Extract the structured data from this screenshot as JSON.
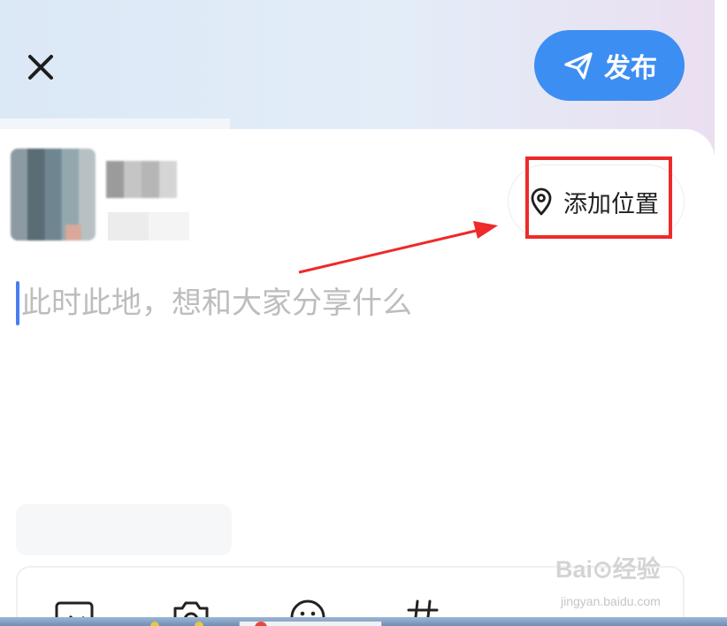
{
  "header": {
    "close_icon": "close-icon",
    "publish_label": "发布",
    "publish_icon": "send-icon"
  },
  "user": {
    "avatar": "avatar",
    "name_hidden": true
  },
  "location": {
    "label": "添加位置",
    "icon": "location-pin-icon"
  },
  "composer": {
    "placeholder": "此时此地，想和大家分享什么"
  },
  "toolbar": {
    "tools": [
      {
        "name": "image-icon"
      },
      {
        "name": "camera-icon"
      },
      {
        "name": "emoji-icon"
      },
      {
        "name": "topic-hash-icon"
      }
    ]
  },
  "watermark": {
    "brand": "Bai⊙经验",
    "url": "jingyan.baidu.com"
  },
  "colors": {
    "accent": "#3d8ef2",
    "highlight": "#ee2a2a",
    "cursor": "#4a7cf0"
  }
}
